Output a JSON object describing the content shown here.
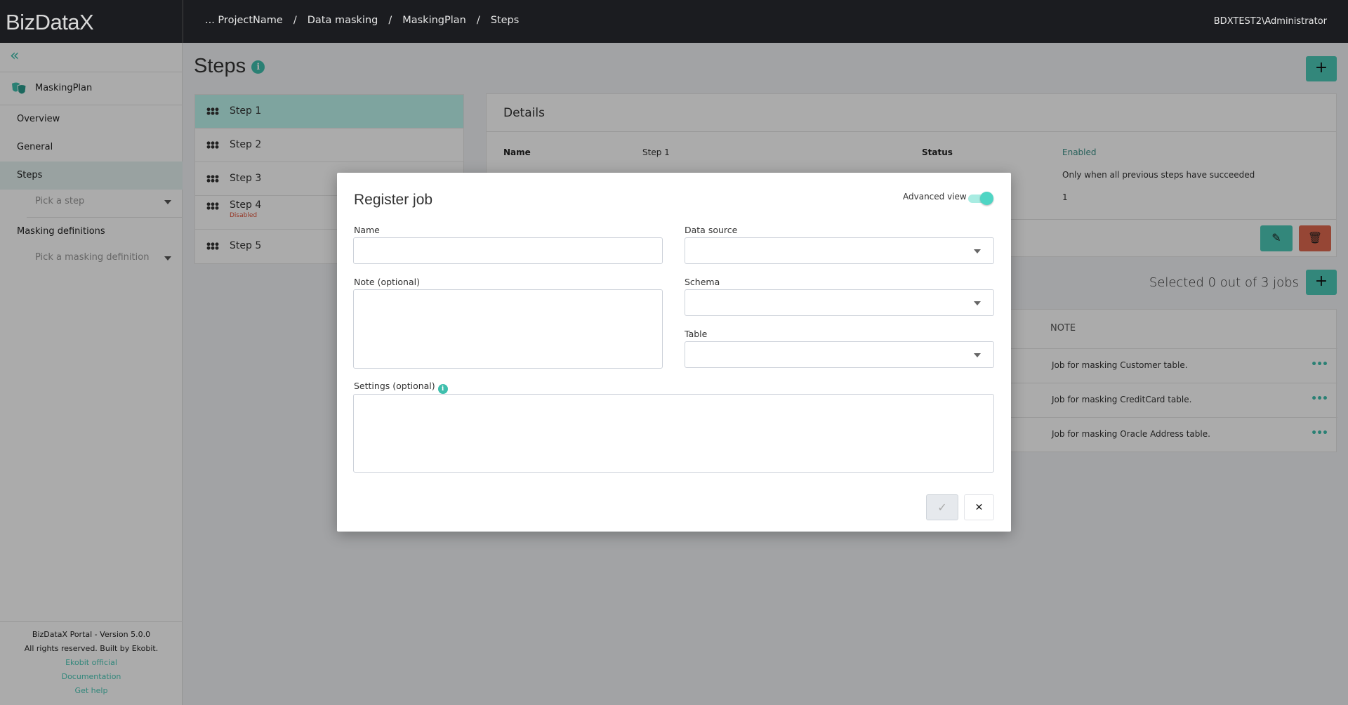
{
  "header": {
    "logo": "BizDataX",
    "breadcrumb": [
      "... ProjectName",
      "Data masking",
      "MaskingPlan",
      "Steps"
    ],
    "separator": "/",
    "user": "BDXTEST2\\Administrator"
  },
  "sidebar": {
    "plan_name": "MaskingPlan",
    "items": [
      {
        "label": "Overview"
      },
      {
        "label": "General"
      },
      {
        "label": "Steps"
      },
      {
        "label": "Masking definitions"
      }
    ],
    "pick_step": "Pick a step",
    "pick_definition": "Pick a masking definition",
    "footer": {
      "version": "BizDataX Portal - Version 5.0.0",
      "rights": "All rights reserved. Built by Ekobit.",
      "links": [
        "Ekobit official",
        "Documentation",
        "Get help"
      ]
    }
  },
  "main": {
    "title": "Steps",
    "add_label": "+",
    "steps": [
      {
        "label": "Step 1",
        "active": true
      },
      {
        "label": "Step 2"
      },
      {
        "label": "Step 3"
      },
      {
        "label": "Step 4",
        "badge": "Disabled"
      },
      {
        "label": "Step 5"
      }
    ],
    "details": {
      "title": "Details",
      "name_label": "Name",
      "name_value": "Step 1",
      "status_label": "Status",
      "status_value": "Enabled",
      "precondition_value": "Only when all previous steps have succeeded",
      "order_value": "1"
    },
    "jobs": {
      "selected_text": "Selected 0 out of 3 jobs",
      "column_note": "NOTE",
      "rows": [
        {
          "note": "Job for masking Customer table."
        },
        {
          "note": "Job for masking CreditCard table."
        },
        {
          "note": "Job for masking Oracle Address table."
        }
      ]
    }
  },
  "modal": {
    "title": "Register job",
    "advanced_view_label": "Advanced view",
    "advanced_view": true,
    "fields": {
      "name": {
        "label": "Name",
        "value": ""
      },
      "note": {
        "label": "Note (optional)",
        "value": ""
      },
      "data_source": {
        "label": "Data source",
        "value": ""
      },
      "schema": {
        "label": "Schema",
        "value": ""
      },
      "table": {
        "label": "Table",
        "value": ""
      },
      "settings": {
        "label": "Settings (optional)",
        "value": ""
      }
    },
    "confirm_icon": "✓",
    "cancel_icon": "✕"
  },
  "colors": {
    "accent": "#4cc9b8",
    "danger": "#e0694f",
    "header": "#1b1c20"
  }
}
